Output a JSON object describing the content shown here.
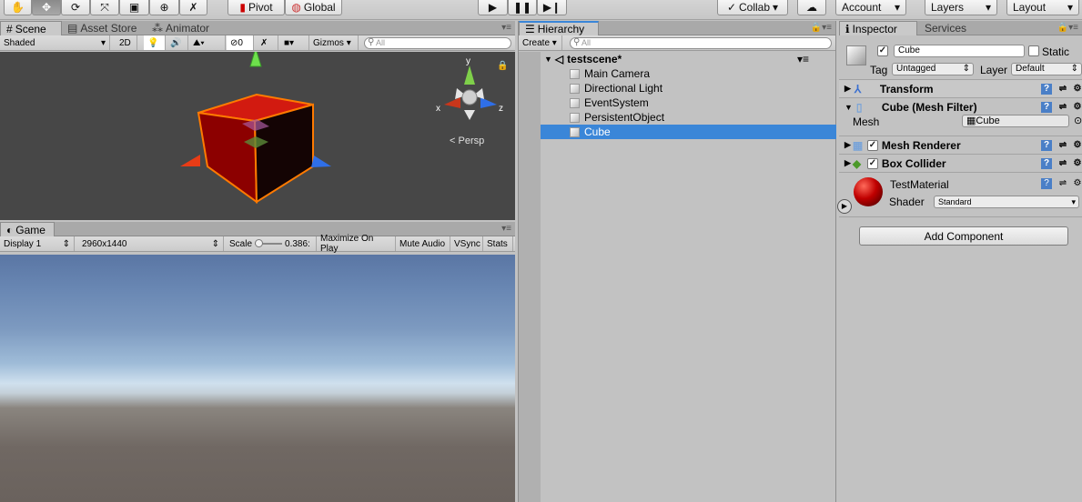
{
  "toolbar": {
    "pivot": "Pivot",
    "global": "Global",
    "collab": "Collab",
    "account": "Account",
    "layers": "Layers",
    "layout": "Layout"
  },
  "scene": {
    "tabs": [
      "Scene",
      "Asset Store",
      "Animator"
    ],
    "shading": "Shaded",
    "mode_2d": "2D",
    "fx_count": "0",
    "gizmos": "Gizmos",
    "search_placeholder": "All",
    "gizmo_labels": {
      "y": "y",
      "x": "x",
      "z": "z"
    },
    "persp": "Persp"
  },
  "game": {
    "tab": "Game",
    "display": "Display 1",
    "resolution": "2960x1440",
    "scale_label": "Scale",
    "scale_value": "0.386:",
    "maximize": "Maximize On Play",
    "mute": "Mute Audio",
    "vsync": "VSync",
    "stats": "Stats"
  },
  "hierarchy": {
    "tab": "Hierarchy",
    "create": "Create",
    "search_placeholder": "All",
    "scene_name": "testscene*",
    "items": [
      "Main Camera",
      "Directional Light",
      "EventSystem",
      "PersistentObject",
      "Cube"
    ],
    "selected_index": 4
  },
  "inspector": {
    "tabs": [
      "Inspector",
      "Services"
    ],
    "object_name": "Cube",
    "static_label": "Static",
    "tag_label": "Tag",
    "tag_value": "Untagged",
    "layer_label": "Layer",
    "layer_value": "Default",
    "components": [
      "Transform",
      "Cube (Mesh Filter)",
      "Mesh Renderer",
      "Box Collider"
    ],
    "mesh_label": "Mesh",
    "mesh_value": "Cube",
    "material_name": "TestMaterial",
    "shader_label": "Shader",
    "shader_value": "Standard",
    "add_component": "Add Component"
  },
  "colors": {
    "selection": "#3a86d8",
    "cube_red": "#b80000",
    "outline": "#ff7a00"
  }
}
